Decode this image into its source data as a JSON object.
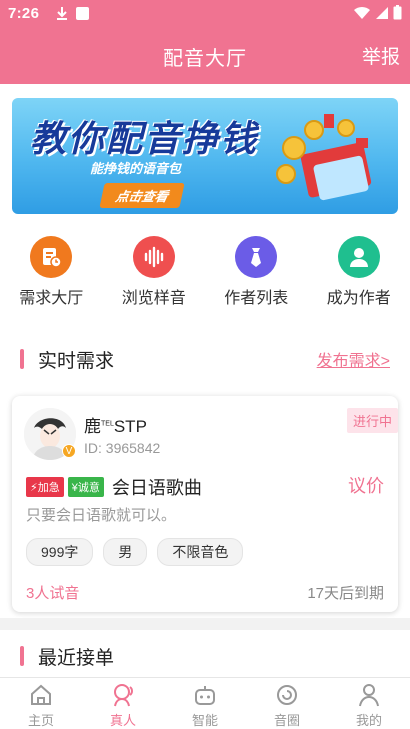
{
  "status_bar": {
    "time": "7:26"
  },
  "header": {
    "title": "配音大厅",
    "report_label": "举报"
  },
  "banner": {
    "title": "教你配音挣钱",
    "subtitle": "能挣钱的语音包",
    "button_label": "点击查看"
  },
  "quick_actions": [
    {
      "label": "需求大厅",
      "icon": "document-clock-icon",
      "color": "#f0791e"
    },
    {
      "label": "浏览样音",
      "icon": "sound-wave-icon",
      "color": "#ef4f4f"
    },
    {
      "label": "作者列表",
      "icon": "tie-icon",
      "color": "#6b5ce7"
    },
    {
      "label": "成为作者",
      "icon": "person-icon",
      "color": "#1fbf8f"
    }
  ],
  "live_requests": {
    "section_title": "实时需求",
    "publish_link": "发布需求>",
    "card": {
      "user_name": "鹿",
      "user_name_super": "TEL",
      "user_name_rest": "STP",
      "user_id": "ID: 3965842",
      "status": "进行中",
      "tag_urgent": "加急",
      "tag_sincere": "诚意",
      "title": "会日语歌曲",
      "price": "议价",
      "description": "只要会日语歌就可以。",
      "chips": [
        "999字",
        "男",
        "不限音色"
      ],
      "tries": "3人试音",
      "expires": "17天后到期"
    }
  },
  "recent_orders": {
    "section_title": "最近接单"
  },
  "tabbar": [
    {
      "label": "主页",
      "icon": "home-icon",
      "active": false
    },
    {
      "label": "真人",
      "icon": "person-voice-icon",
      "active": true
    },
    {
      "label": "智能",
      "icon": "robot-icon",
      "active": false
    },
    {
      "label": "音圈",
      "icon": "circle-refresh-icon",
      "active": false
    },
    {
      "label": "我的",
      "icon": "user-icon",
      "active": false
    }
  ],
  "colors": {
    "brand": "#f07391",
    "urgent": "#e8374a",
    "sincere": "#39b54a"
  }
}
